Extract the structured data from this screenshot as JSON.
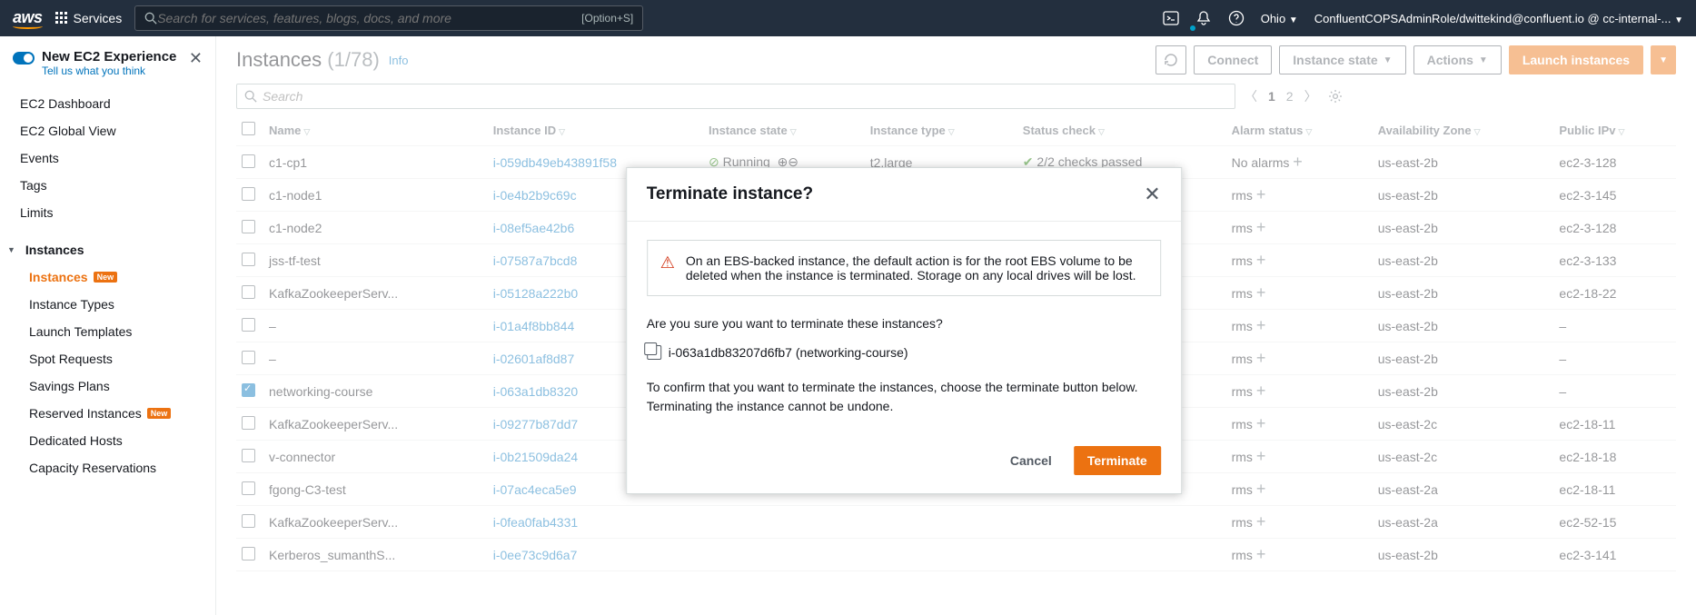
{
  "topnav": {
    "logo": "aws",
    "services": "Services",
    "search_placeholder": "Search for services, features, blogs, docs, and more",
    "search_shortcut": "[Option+S]",
    "region": "Ohio",
    "account": "ConfluentCOPSAdminRole/dwittekind@confluent.io @ cc-internal-..."
  },
  "sidebar": {
    "banner_title": "New EC2 Experience",
    "banner_sub": "Tell us what you think",
    "top_items": [
      "EC2 Dashboard",
      "EC2 Global View",
      "Events",
      "Tags",
      "Limits"
    ],
    "section": "Instances",
    "instance_items": [
      {
        "label": "Instances",
        "active": true,
        "badge": "New"
      },
      {
        "label": "Instance Types"
      },
      {
        "label": "Launch Templates"
      },
      {
        "label": "Spot Requests"
      },
      {
        "label": "Savings Plans"
      },
      {
        "label": "Reserved Instances",
        "badge": "New"
      },
      {
        "label": "Dedicated Hosts"
      },
      {
        "label": "Capacity Reservations"
      }
    ]
  },
  "header": {
    "title": "Instances",
    "count": "(1/78)",
    "info": "Info",
    "connect": "Connect",
    "instance_state": "Instance state",
    "actions": "Actions",
    "launch": "Launch instances"
  },
  "search": {
    "placeholder": "Search"
  },
  "pager": {
    "page1": "1",
    "page2": "2"
  },
  "columns": [
    "Name",
    "Instance ID",
    "Instance state",
    "Instance type",
    "Status check",
    "Alarm status",
    "Availability Zone",
    "Public IPv"
  ],
  "rows": [
    {
      "name": "c1-cp1",
      "id": "i-059db49eb43891f58",
      "state": "Running",
      "type": "t2.large",
      "check": "2/2 checks passed",
      "alarm": "No alarms",
      "az": "us-east-2b",
      "ip": "ec2-3-128"
    },
    {
      "name": "c1-node1",
      "id": "i-0e4b2b9c69c",
      "state": "",
      "type": "",
      "check": "",
      "alarm": "rms",
      "az": "us-east-2b",
      "ip": "ec2-3-145"
    },
    {
      "name": "c1-node2",
      "id": "i-08ef5ae42b6",
      "state": "",
      "type": "",
      "check": "",
      "alarm": "rms",
      "az": "us-east-2b",
      "ip": "ec2-3-128"
    },
    {
      "name": "jss-tf-test",
      "id": "i-07587a7bcd8",
      "state": "",
      "type": "",
      "check": "",
      "alarm": "rms",
      "az": "us-east-2b",
      "ip": "ec2-3-133"
    },
    {
      "name": "KafkaZookeeperServ...",
      "id": "i-05128a222b0",
      "state": "",
      "type": "",
      "check": "",
      "alarm": "rms",
      "az": "us-east-2b",
      "ip": "ec2-18-22"
    },
    {
      "name": "–",
      "id": "i-01a4f8bb844",
      "state": "",
      "type": "",
      "check": "",
      "alarm": "rms",
      "az": "us-east-2b",
      "ip": "–"
    },
    {
      "name": "–",
      "id": "i-02601af8d87",
      "state": "",
      "type": "",
      "check": "",
      "alarm": "rms",
      "az": "us-east-2b",
      "ip": "–"
    },
    {
      "name": "networking-course",
      "id": "i-063a1db8320",
      "state": "",
      "type": "",
      "check": "",
      "alarm": "rms",
      "az": "us-east-2b",
      "ip": "–",
      "checked": true
    },
    {
      "name": "KafkaZookeeperServ...",
      "id": "i-09277b87dd7",
      "state": "",
      "type": "",
      "check": "",
      "alarm": "rms",
      "az": "us-east-2c",
      "ip": "ec2-18-11"
    },
    {
      "name": "v-connector",
      "id": "i-0b21509da24",
      "state": "",
      "type": "",
      "check": "",
      "alarm": "rms",
      "az": "us-east-2c",
      "ip": "ec2-18-18"
    },
    {
      "name": "fgong-C3-test",
      "id": "i-07ac4eca5e9",
      "state": "",
      "type": "",
      "check": "",
      "alarm": "rms",
      "az": "us-east-2a",
      "ip": "ec2-18-11"
    },
    {
      "name": "KafkaZookeeperServ...",
      "id": "i-0fea0fab4331",
      "state": "",
      "type": "",
      "check": "",
      "alarm": "rms",
      "az": "us-east-2a",
      "ip": "ec2-52-15"
    },
    {
      "name": "Kerberos_sumanthS...",
      "id": "i-0ee73c9d6a7",
      "state": "",
      "type": "",
      "check": "",
      "alarm": "rms",
      "az": "us-east-2b",
      "ip": "ec2-3-141"
    }
  ],
  "modal": {
    "title": "Terminate instance?",
    "warning": "On an EBS-backed instance, the default action is for the root EBS volume to be deleted when the instance is terminated. Storage on any local drives will be lost.",
    "confirm_q": "Are you sure you want to terminate these instances?",
    "instance_line": "i-063a1db83207d6fb7 (networking-course)",
    "confirm_text": "To confirm that you want to terminate the instances, choose the terminate button below. Terminating the instance cannot be undone.",
    "cancel": "Cancel",
    "terminate": "Terminate"
  }
}
